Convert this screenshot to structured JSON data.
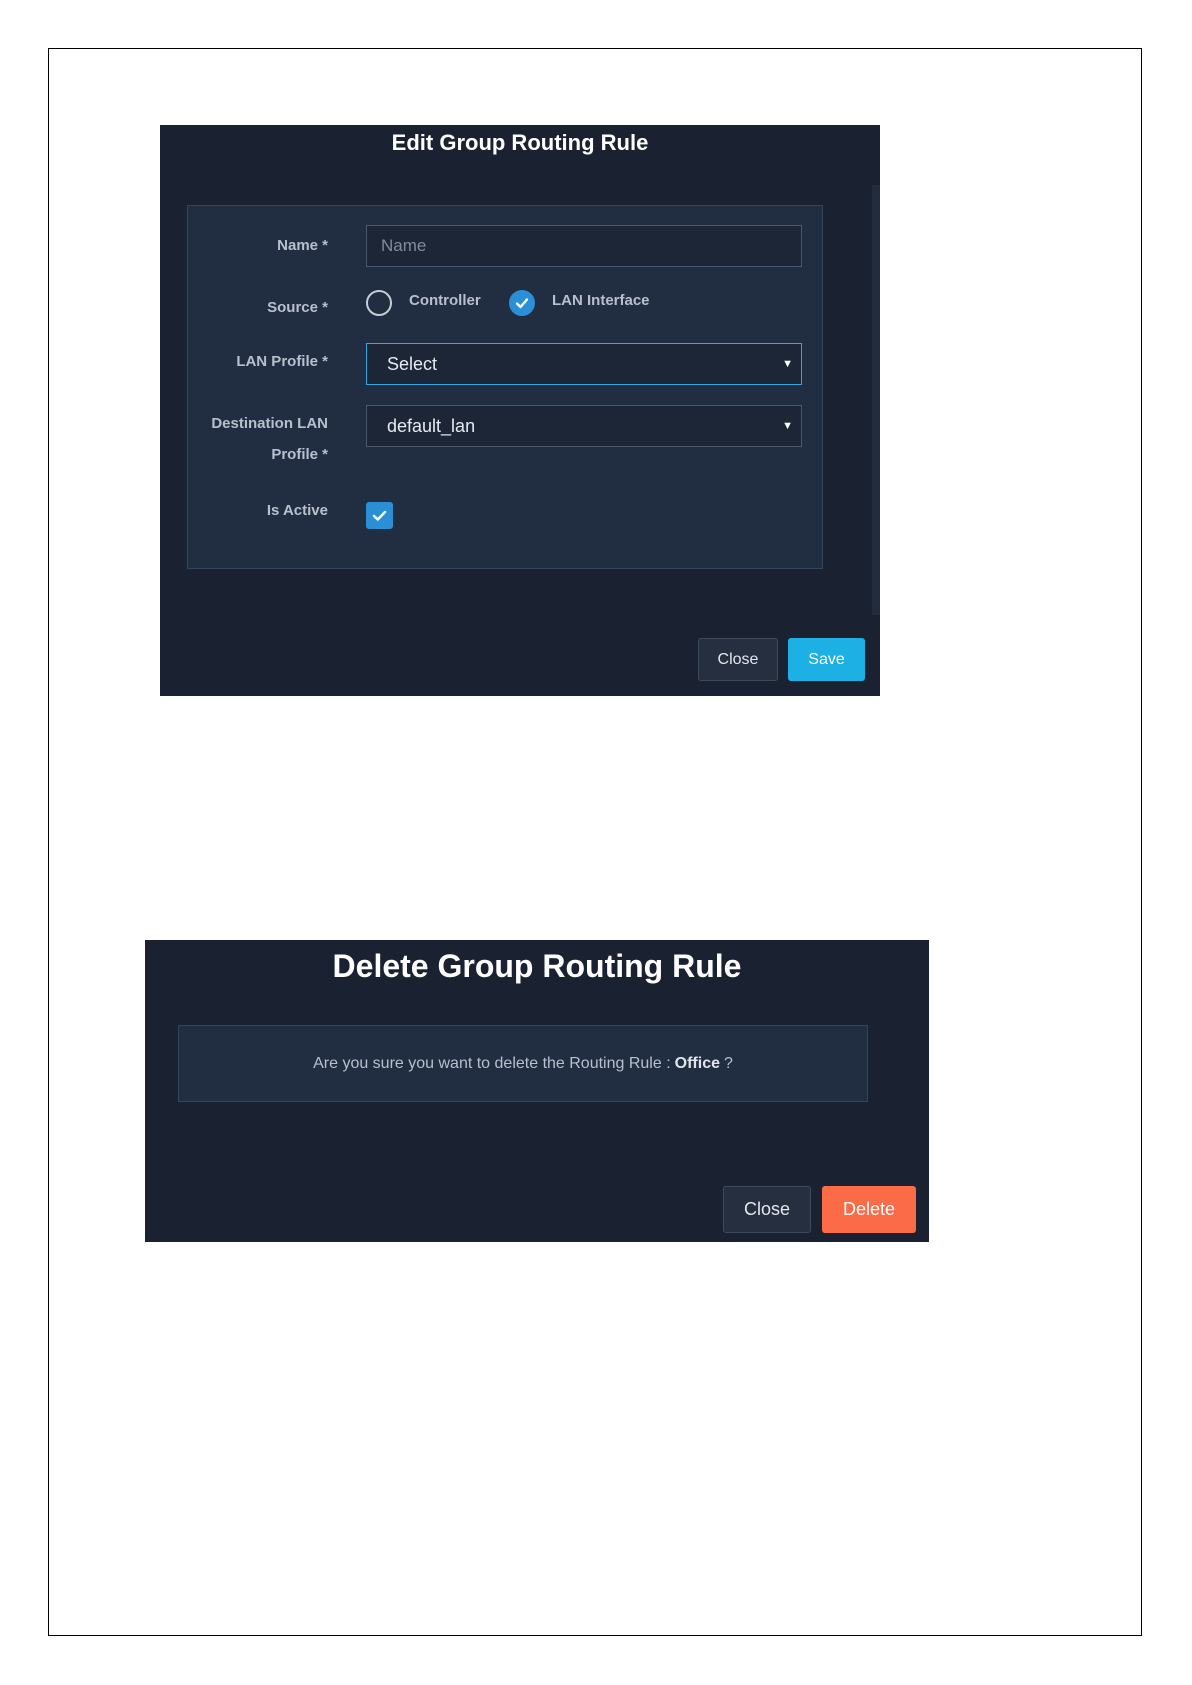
{
  "edit_modal": {
    "title": "Edit Group Routing Rule",
    "name_label": "Name *",
    "name_placeholder": "Name",
    "source_label": "Source *",
    "source_options": [
      {
        "label": "Controller",
        "selected": false
      },
      {
        "label": "LAN Interface",
        "selected": true
      }
    ],
    "lan_profile_label": "LAN Profile *",
    "lan_profile_value": "Select",
    "dest_label_line1": "Destination LAN",
    "dest_label_line2": "Profile *",
    "dest_value": "default_lan",
    "is_active_label": "Is Active",
    "is_active_checked": true,
    "close_label": "Close",
    "save_label": "Save"
  },
  "delete_modal": {
    "title": "Delete Group Routing Rule",
    "message": "Are you sure you want to delete the Routing Rule :",
    "rule_name": "Office",
    "question_mark": "?",
    "close_label": "Close",
    "delete_label": "Delete"
  },
  "colors": {
    "modal_bg": "#1a2231",
    "panel_bg": "#212d40",
    "accent_blue": "#2b8fd6",
    "save_cyan": "#1db0e4",
    "delete_orange": "#fb6b47"
  },
  "icons": {
    "check": "check-icon",
    "caret": "caret-down-icon"
  }
}
